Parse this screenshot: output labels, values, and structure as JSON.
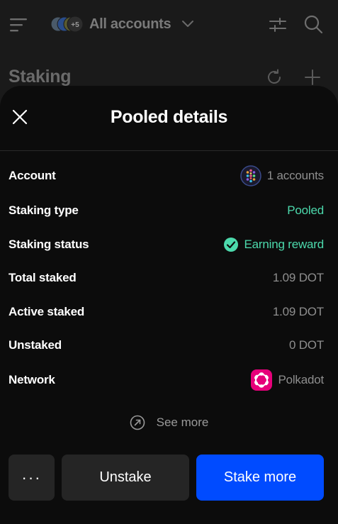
{
  "topbar": {
    "menu_icon": "hamburger-menu-icon",
    "avatars_badge": "+5",
    "account_selector_label": "All accounts",
    "chevron_icon": "chevron-down-icon",
    "filter_icon": "sliders-icon",
    "search_icon": "search-icon"
  },
  "background": {
    "title": "Staking",
    "reload_icon": "reload-icon",
    "add_icon": "plus-icon"
  },
  "sheet": {
    "title": "Pooled details",
    "close_icon": "close-icon",
    "rows": [
      {
        "label": "Account",
        "value": "1 accounts"
      },
      {
        "label": "Staking type",
        "value": "Pooled"
      },
      {
        "label": "Staking status",
        "value": "Earning reward"
      },
      {
        "label": "Total staked",
        "value": "1.09 DOT"
      },
      {
        "label": "Active staked",
        "value": "1.09 DOT"
      },
      {
        "label": "Unstaked",
        "value": "0 DOT"
      },
      {
        "label": "Network",
        "value": "Polkadot"
      }
    ],
    "see_more_label": "See more",
    "see_more_icon": "external-arrow-icon",
    "more_label": "···",
    "unstake_label": "Unstake",
    "stake_more_label": "Stake more"
  },
  "colors": {
    "accent_blue": "#004bff",
    "success_green": "#4cd9ac",
    "polkadot_pink": "#e6007a"
  }
}
